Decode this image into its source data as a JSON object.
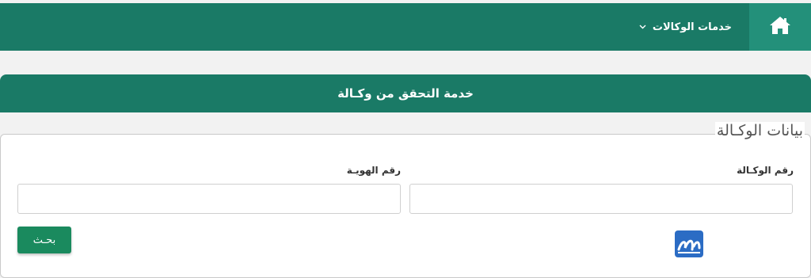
{
  "nav": {
    "home_icon": "home-icon",
    "menu_label": "خدمات الوكالات",
    "menu_chevron": "chevron-down-icon"
  },
  "page": {
    "title": "خدمة التحقق من وكـالة"
  },
  "form": {
    "legend": "بيانات الوكـالة",
    "agency_number_label": "رقم الوكـالة",
    "agency_number_value": "",
    "id_number_label": "رقم الهويـة",
    "id_number_value": "",
    "search_label": "بحـث"
  },
  "colors": {
    "brand": "#1a7a66",
    "home_box": "#23907a",
    "button": "#1a8a5e",
    "logo": "#2b6cc4"
  }
}
